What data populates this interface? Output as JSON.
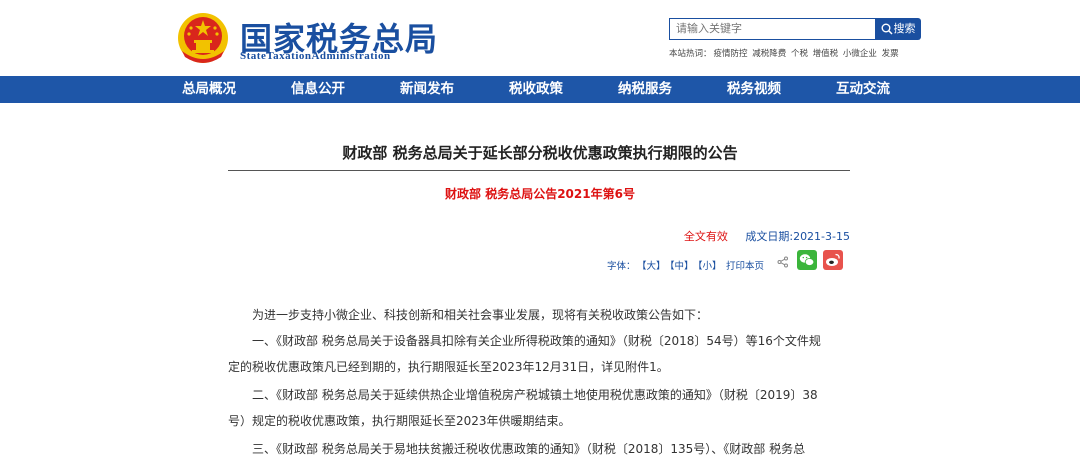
{
  "header": {
    "logo_cn": "国家税务总局",
    "logo_en": "StateTaxationAdministration",
    "search_placeholder": "请输入关键字",
    "search_button": "搜索",
    "hot_label": "本站热词：",
    "hot_words": [
      "疫情防控",
      "减税降费",
      "个税",
      "增值税",
      "小微企业",
      "发票"
    ]
  },
  "nav": [
    "总局概况",
    "信息公开",
    "新闻发布",
    "税收政策",
    "纳税服务",
    "税务视频",
    "互动交流"
  ],
  "article": {
    "title": "财政部 税务总局关于延长部分税收优惠政策执行期限的公告",
    "doc_number": "财政部 税务总局公告2021年第6号",
    "validity": "全文有效",
    "date": "成文日期:2021-3-15",
    "font_label": "字体：",
    "font_large": "【大】",
    "font_medium": "【中】",
    "font_small": "【小】",
    "print": "打印本页",
    "paragraphs": [
      "为进一步支持小微企业、科技创新和相关社会事业发展，现将有关税收政策公告如下：",
      "一、《财政部 税务总局关于设备器具扣除有关企业所得税政策的通知》（财税〔2018〕54号）等16个文件规",
      "定的税收优惠政策凡已经到期的，执行期限延长至2023年12月31日，详见附件1。",
      "二、《财政部 税务总局关于延续供热企业增值税房产税城镇土地使用税优惠政策的通知》（财税〔2019〕38",
      "号）规定的税收优惠政策，执行期限延长至2023年供暖期结束。",
      "三、《财政部 税务总局关于易地扶贫搬迁税收优惠政策的通知》（财税〔2018〕135号）、《财政部 税务总"
    ]
  },
  "colors": {
    "brand": "#1a4fa0",
    "nav": "#1e56a8",
    "accent_red": "#dd1111"
  }
}
